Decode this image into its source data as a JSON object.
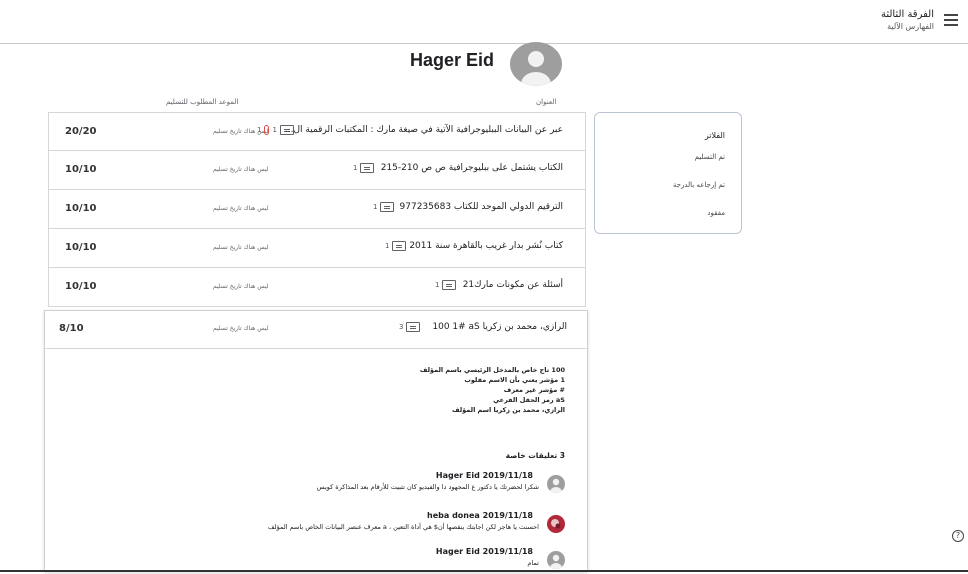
{
  "header": {
    "class_name": "الفرقة الثالثة",
    "class_subject": "الفهارس الآلية"
  },
  "student": {
    "name": "Hager Eid"
  },
  "columns": {
    "title": "العنوان",
    "due": "الموعد المطلوب للتسليم"
  },
  "filters": {
    "heading": "الفلاتر",
    "items": [
      "تم التسليم",
      "تم إرجاعه بالدرجة",
      "مفقود"
    ]
  },
  "assignments": [
    {
      "title": "عبر عن البيانات الببليوجرافية الآتية في صيغة مارك : المكتبات الرقمية ال...",
      "due": "ليس هناك تاريخ تسليم",
      "grade": "20/20",
      "comments": "1",
      "attachments": "1"
    },
    {
      "title": "الكتاب يشتمل على ببليوجرافية ص ص 210-215",
      "due": "ليس هناك تاريخ تسليم",
      "grade": "10/10",
      "comments": "1"
    },
    {
      "title": "الترقيم الدولي الموحد للكتاب 977235683",
      "due": "ليس هناك تاريخ تسليم",
      "grade": "10/10",
      "comments": "1"
    },
    {
      "title": "كتاب نُشر بدار غريب بالقاهرة سنة 2011",
      "due": "ليس هناك تاريخ تسليم",
      "grade": "10/10",
      "comments": "1"
    },
    {
      "title": "أسئلة عن مكونات مارك21",
      "due": "ليس هناك تاريخ تسليم",
      "grade": "10/10",
      "comments": "1"
    }
  ],
  "expanded": {
    "title": "100 1# aS الرازي، محمد بن زكريا",
    "due": "ليس هناك تاريخ تسليم",
    "grade": "8/10",
    "comments": "3",
    "notes": [
      "100 تاج خاص بالمدخل الرئيسي باسم المؤلف",
      "1 مؤشر يعني بأن الاسم مقلوب",
      "# مؤشر غير معرف",
      "aS رمز الحقل الفرعي",
      "الرازي، محمد بن زكريا اسم المؤلف"
    ],
    "private_heading": "3 تعليقات خاصة",
    "private_comments": [
      {
        "author": "Hager Eid",
        "date": "2019/11/18",
        "text": "شكرا لحضرتك يا دكتور ع المجهود دا والفيديو كان تثبيت للأرقام بعد المذاكرة كويس"
      },
      {
        "author": "heba donea",
        "date": "2019/11/18",
        "text": "احسنت يا هاجر لكن اجابتك ينقصها أن$ هي أداة التعين ، a معرف عنصر البيانات الخاص باسم المؤلف"
      },
      {
        "author": "Hager Eid",
        "date": "2019/11/18",
        "text": "تمام"
      }
    ]
  },
  "icons": {
    "menu": "hamburger-menu-icon",
    "comment": "comment-icon",
    "attachment": "attachment-icon",
    "help": "help-icon"
  }
}
